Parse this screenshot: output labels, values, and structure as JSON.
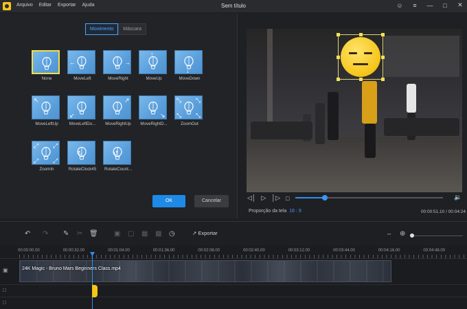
{
  "app": {
    "title": "Sem título",
    "menu": [
      "Arquivo",
      "Editar",
      "Exportar",
      "Ajuda"
    ],
    "accent": "#2e8ff0"
  },
  "motion_panel": {
    "tabs": [
      {
        "label": "Movimento",
        "active": true
      },
      {
        "label": "Máscara",
        "active": false
      }
    ],
    "effects": [
      {
        "label": "None",
        "icon": "balloon-icon",
        "arrows": []
      },
      {
        "label": "MoveLeft",
        "icon": "balloon-icon",
        "arrows": [
          "left"
        ]
      },
      {
        "label": "MoveRight",
        "icon": "balloon-icon",
        "arrows": [
          "right"
        ]
      },
      {
        "label": "MoveUp",
        "icon": "balloon-icon",
        "arrows": [
          "up"
        ]
      },
      {
        "label": "MoveDown",
        "icon": "balloon-icon",
        "arrows": [
          "down"
        ]
      },
      {
        "label": "MoveLeftUp",
        "icon": "balloon-icon",
        "arrows": [
          "up-left"
        ]
      },
      {
        "label": "MoveLeftDo...",
        "icon": "balloon-icon",
        "arrows": [
          "down-left"
        ]
      },
      {
        "label": "MoveRightUp",
        "icon": "balloon-icon",
        "arrows": [
          "up-right"
        ]
      },
      {
        "label": "MoveRightD...",
        "icon": "balloon-icon",
        "arrows": [
          "down-right"
        ]
      },
      {
        "label": "ZoomOut",
        "icon": "balloon-icon",
        "arrows": [
          "corners-in"
        ]
      },
      {
        "label": "ZoomIn",
        "icon": "balloon-icon",
        "arrows": [
          "corners-out"
        ]
      },
      {
        "label": "RotateClock45",
        "icon": "balloon-icon",
        "arrows": [
          "rotate-cw"
        ]
      },
      {
        "label": "RotateCount...",
        "icon": "balloon-icon",
        "arrows": [
          "rotate-ccw"
        ]
      }
    ],
    "selected_index": 0,
    "ok_label": "OK",
    "cancel_label": "Cancelar"
  },
  "preview": {
    "aspect_label": "Proporção da tela",
    "aspect_value": "16 : 9",
    "time": "00:00:51.10 / 00:04:24",
    "progress_fraction": 0.2
  },
  "toolbar": {
    "export_label": "Exportar",
    "tools": [
      "undo-icon",
      "pencil-icon",
      "cut-icon",
      "trash-icon",
      "crop-icon",
      "frame-icon",
      "mosaic-icon",
      "freeze-icon",
      "duration-icon"
    ]
  },
  "timeline": {
    "ruler": [
      "00:00:00.00",
      "00:00:32.00",
      "00:01:04.00",
      "00:01:36.00",
      "00:02:08.00",
      "00:02:40.00",
      "00:03:12.00",
      "00:03:44.00",
      "00:04:16.00",
      "00:04:48.00"
    ],
    "clip_label": "24K Magic - Bruno Mars  Beginners Class.mp4"
  }
}
